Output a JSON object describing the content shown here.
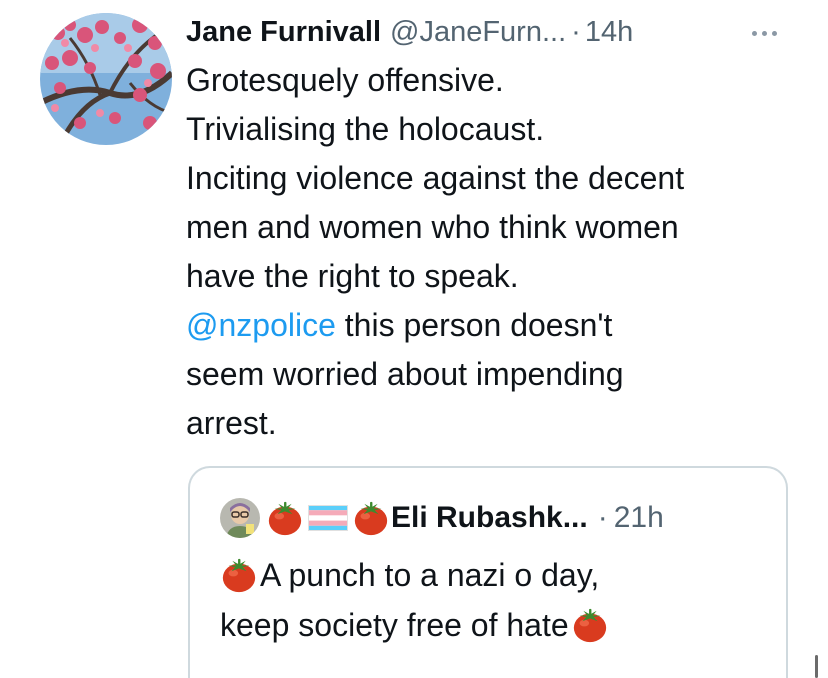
{
  "tweet": {
    "author": {
      "display_name": "Jane Furnivall",
      "handle": "@JaneFurn...",
      "avatar": "cherry-blossom-photo"
    },
    "separator": "·",
    "time": "14h",
    "more_icon": "more-options-icon",
    "lines": [
      "Grotesquely offensive.",
      "Trivialising the holocaust.",
      "Inciting violence against the decent",
      "men and women who think women",
      "have the right to speak."
    ],
    "mention": "@nzpolice",
    "mention_line_rest": " this person doesn't",
    "lines_after": [
      "seem worried about impending",
      "arrest."
    ]
  },
  "quoted_tweet": {
    "author": {
      "display_name": "Eli Rubashk...",
      "avatar": "cartoon-avatar",
      "name_emojis": [
        "tomato-icon",
        "transgender-flag-icon",
        "tomato-icon"
      ]
    },
    "separator": "·",
    "time": "21h",
    "line1_emoji": "tomato-icon",
    "line1": "A punch to a nazi o day,",
    "line2": "keep society free of hate",
    "line2_emoji": "tomato-icon"
  },
  "colors": {
    "text": "#0f1419",
    "secondary": "#536471",
    "link": "#1d9bf0",
    "border": "#cfd9de"
  }
}
